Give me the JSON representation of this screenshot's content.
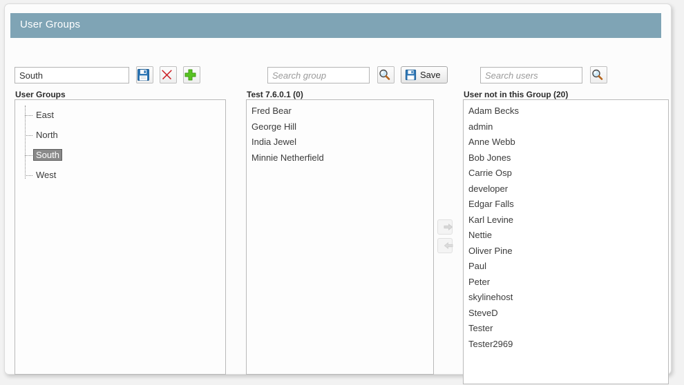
{
  "window": {
    "title": "User Groups"
  },
  "toolbar": {
    "group_name_value": "South",
    "group_name_placeholder": "",
    "save_icon_title": "Save",
    "delete_icon_title": "Delete",
    "add_icon_title": "Add"
  },
  "group_search": {
    "placeholder": "Search group",
    "value": "",
    "search_icon_title": "Search",
    "save_label": "Save"
  },
  "user_search": {
    "placeholder": "Search users",
    "value": "",
    "search_icon_title": "Search"
  },
  "tree_panel": {
    "caption": "User Groups",
    "items": [
      {
        "label": "East",
        "selected": false
      },
      {
        "label": "North",
        "selected": false
      },
      {
        "label": "South",
        "selected": true
      },
      {
        "label": "West",
        "selected": false
      }
    ]
  },
  "group_members": {
    "caption": "Test 7.6.0.1 (0)",
    "items": [
      "Fred Bear",
      "George Hill",
      "India Jewel",
      "Minnie Netherfield"
    ]
  },
  "transfer": {
    "add_to_group_label": "→",
    "remove_from_group_label": "←"
  },
  "non_members": {
    "caption": "User not in this Group (20)",
    "items": [
      "Adam Becks",
      "admin",
      "Anne Webb",
      "Bob Jones",
      "Carrie Osp",
      "developer",
      "Edgar Falls",
      "Karl Levine",
      "Nettie",
      "Oliver Pine",
      "Paul",
      "Peter",
      "skylinehost",
      "SteveD",
      "Tester",
      "Tester2969"
    ]
  },
  "colors": {
    "header_bar": "#7fa4b5",
    "header_text": "#ffffff",
    "selection": "#8a8a8a",
    "page_background": "#f2f2f2",
    "panel_background": "#fcfcfc"
  }
}
